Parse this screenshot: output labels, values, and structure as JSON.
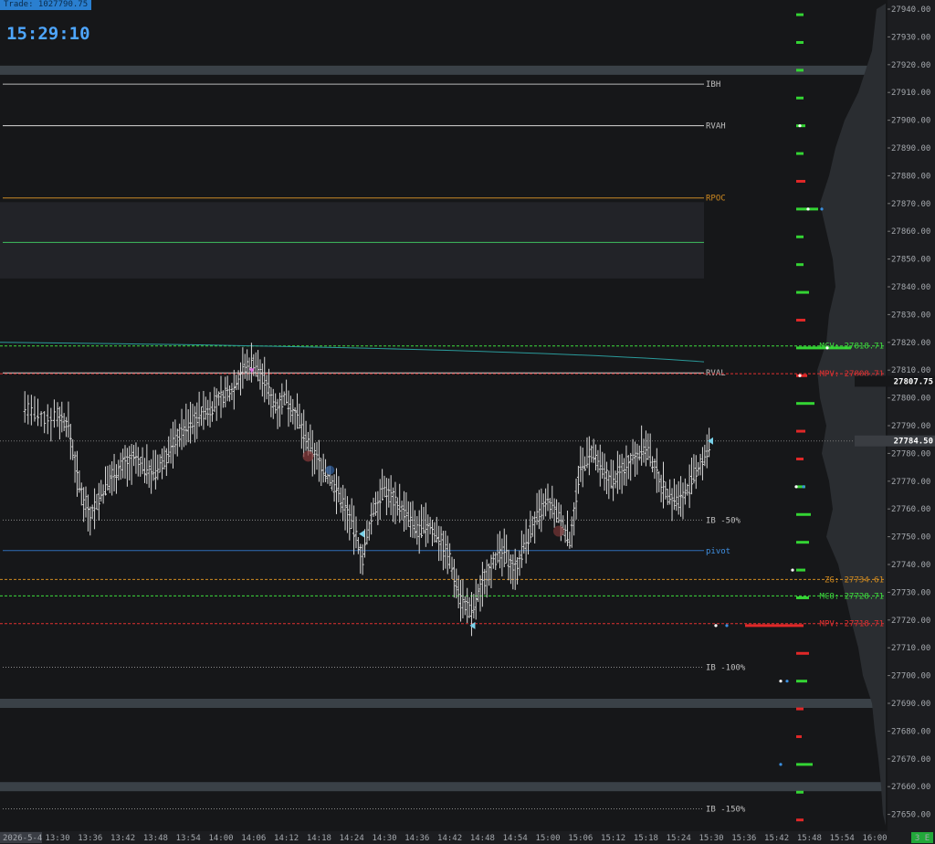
{
  "header": {
    "trade_label": "Trade: 1027790.75",
    "clock": "15:29:10"
  },
  "chart_data": {
    "type": "ohlc_bar_with_volume_profile",
    "symbol_date": "2026-5-4",
    "y_axis_ticks": [
      27650,
      27660,
      27670,
      27680,
      27690,
      27700,
      27710,
      27720,
      27730,
      27740,
      27750,
      27760,
      27770,
      27780,
      27790,
      27800,
      27810,
      27820,
      27830,
      27840,
      27850,
      27860,
      27870,
      27880,
      27890,
      27900,
      27910,
      27920,
      27930,
      27940
    ],
    "ylim": [
      27646,
      27942
    ],
    "x_axis_ticks": [
      "13:30",
      "13:36",
      "13:42",
      "13:48",
      "13:54",
      "14:00",
      "14:06",
      "14:12",
      "14:18",
      "14:24",
      "14:30",
      "14:36",
      "14:42",
      "14:48",
      "14:54",
      "15:00",
      "15:06",
      "15:12",
      "15:18",
      "15:24",
      "15:30",
      "15:36",
      "15:42",
      "15:48",
      "15:54",
      "16:00"
    ],
    "x_axis_first_label": "2026-5-4",
    "corner_badge": "3 E",
    "price_path": [
      [
        "13:24",
        27797
      ],
      [
        "13:27",
        27792
      ],
      [
        "13:30",
        27794
      ],
      [
        "13:32",
        27790
      ],
      [
        "13:34",
        27768
      ],
      [
        "13:36",
        27758
      ],
      [
        "13:38",
        27765
      ],
      [
        "13:40",
        27772
      ],
      [
        "13:42",
        27776
      ],
      [
        "13:44",
        27778
      ],
      [
        "13:46",
        27775
      ],
      [
        "13:48",
        27773
      ],
      [
        "13:50",
        27779
      ],
      [
        "13:52",
        27786
      ],
      [
        "13:54",
        27790
      ],
      [
        "13:56",
        27794
      ],
      [
        "13:58",
        27796
      ],
      [
        "14:00",
        27800
      ],
      [
        "14:02",
        27803
      ],
      [
        "14:04",
        27810
      ],
      [
        "14:06",
        27813
      ],
      [
        "14:08",
        27806
      ],
      [
        "14:10",
        27797
      ],
      [
        "14:12",
        27800
      ],
      [
        "14:14",
        27793
      ],
      [
        "14:16",
        27783
      ],
      [
        "14:18",
        27777
      ],
      [
        "14:20",
        27771
      ],
      [
        "14:22",
        27764
      ],
      [
        "14:24",
        27755
      ],
      [
        "14:26",
        27742
      ],
      [
        "14:28",
        27760
      ],
      [
        "14:30",
        27767
      ],
      [
        "14:32",
        27763
      ],
      [
        "14:34",
        27758
      ],
      [
        "14:36",
        27752
      ],
      [
        "14:38",
        27754
      ],
      [
        "14:40",
        27750
      ],
      [
        "14:42",
        27742
      ],
      [
        "14:44",
        27728
      ],
      [
        "14:46",
        27722
      ],
      [
        "14:48",
        27733
      ],
      [
        "14:50",
        27742
      ],
      [
        "14:52",
        27744
      ],
      [
        "14:54",
        27738
      ],
      [
        "14:56",
        27748
      ],
      [
        "14:58",
        27757
      ],
      [
        "15:00",
        27762
      ],
      [
        "15:02",
        27757
      ],
      [
        "15:04",
        27749
      ],
      [
        "15:06",
        27774
      ],
      [
        "15:08",
        27780
      ],
      [
        "15:10",
        27773
      ],
      [
        "15:12",
        27770
      ],
      [
        "15:14",
        27775
      ],
      [
        "15:16",
        27780
      ],
      [
        "15:18",
        27782
      ],
      [
        "15:20",
        27773
      ],
      [
        "15:22",
        27765
      ],
      [
        "15:24",
        27763
      ],
      [
        "15:26",
        27768
      ],
      [
        "15:28",
        27776
      ],
      [
        "15:30",
        27783
      ]
    ],
    "levels": [
      {
        "name": "IBH",
        "price": 27913,
        "color": "#b8b8b8",
        "style": "solid"
      },
      {
        "name": "RVAH",
        "price": 27898,
        "color": "#d8d8d8",
        "style": "solid"
      },
      {
        "name": "RPOC",
        "price": 27872,
        "color": "#c98a28",
        "style": "solid"
      },
      {
        "name": "",
        "price": 27856,
        "color": "#3fbf5f",
        "style": "solid"
      },
      {
        "name": "RVAL",
        "price": 27809,
        "color": "#d8d8d8",
        "style": "solid"
      },
      {
        "name": "IB -50%",
        "price": 27756,
        "color": "#8a8a8a",
        "style": "dotted"
      },
      {
        "name": "pivot",
        "price": 27745,
        "color": "#2f6fb8",
        "style": "solid"
      },
      {
        "name": "IB -100%",
        "price": 27703,
        "color": "#8a8a8a",
        "style": "dotted"
      },
      {
        "name": "IB -150%",
        "price": 27652,
        "color": "#8a8a8a",
        "style": "dotted"
      }
    ],
    "profile_levels": [
      {
        "label": "MCV: 27818.71",
        "price": 27818.71,
        "color": "#3ddc3d"
      },
      {
        "label": "MPV: 27808.71",
        "price": 27808.71,
        "color": "#e03030"
      },
      {
        "label": "ZG: 27734.61",
        "price": 27734.61,
        "color": "#d08a20"
      },
      {
        "label": "MCO: 27728.71",
        "price": 27728.71,
        "color": "#3ddc3d"
      },
      {
        "label": "MPV: 27718.71",
        "price": 27718.71,
        "color": "#e03030"
      }
    ],
    "price_tags": [
      {
        "label": "27807.75",
        "price": 27806
      },
      {
        "label": "27784.50",
        "price": 27784.5
      }
    ],
    "last_price": 27784.5,
    "value_area_box": {
      "top": 27870.5,
      "bottom": 27843
    },
    "ib_bands": [
      27918,
      27690,
      27660
    ]
  }
}
